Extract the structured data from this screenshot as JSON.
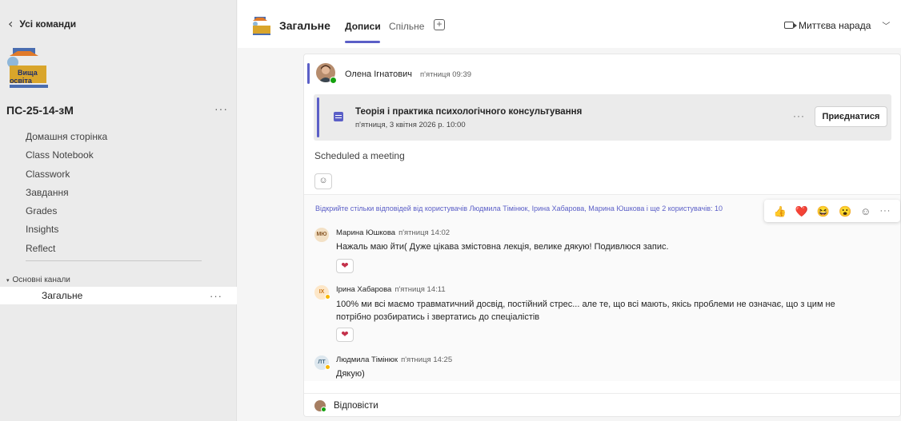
{
  "sidebar": {
    "back_label": "Усі команди",
    "team_name": "ПС-25-14-зМ",
    "team_logo_text": "Вища освіта",
    "more_glyph": "···",
    "nav_items": [
      {
        "label": "Домашня сторінка"
      },
      {
        "label": "Class Notebook"
      },
      {
        "label": "Classwork"
      },
      {
        "label": "Завдання"
      },
      {
        "label": "Grades"
      },
      {
        "label": "Insights"
      },
      {
        "label": "Reflect"
      }
    ],
    "section_label": "Основні канали",
    "channel_label": "Загальне"
  },
  "header": {
    "title": "Загальне",
    "tabs": [
      {
        "label": "Дописи",
        "active": true
      },
      {
        "label": "Спільне",
        "active": false
      }
    ],
    "add_tab_glyph": "+",
    "meet_label": "Миттєва нарада"
  },
  "post": {
    "author": "Олена Ігнатович",
    "time": "п'ятниця 09:39",
    "meeting": {
      "title": "Теорія і практика психологічного консультування",
      "date": "п'ятниця, 3 квітня 2026 р. 10:00",
      "join_label": "Приєднатися",
      "more_glyph": "···"
    },
    "body": "Scheduled a meeting",
    "open_replies": "Відкрийте стільки відповідей від користувачів Людмила Тімінюк, Ірина Хабарова, Марина Юшкова і ще 2 користувачів: 10",
    "reactions": [
      "👍",
      "❤️",
      "😆",
      "😮",
      "☺",
      "···"
    ],
    "replies": [
      {
        "initials": "МЮ",
        "author": "Марина Юшкова",
        "time": "п'ятниця 14:02",
        "text": "Нажаль маю йти(  Дуже цікава змістовна лекція, велике дякую!  Подивлюся запис.",
        "reaction": "❤"
      },
      {
        "initials": "ІХ",
        "author": "Ірина Хабарова",
        "time": "п'ятниця 14:11",
        "text": "100% ми всі маємо травматичний досвід, постійний стрес... але те, що всі мають, якісь проблеми не означає, що з цим не потрібно розбиратись і звертатись до спеціалістів",
        "reaction": "❤"
      },
      {
        "initials": "ЛТ",
        "author": "Людмила Тімінюк",
        "time": "п'ятниця 14:25",
        "text": "Дякую)"
      }
    ],
    "reply_label": "Відповісти"
  },
  "colors": {
    "accent": "#5b5fc7",
    "heart": "#c4314b",
    "presence_online": "#13a10e",
    "presence_away": "#f8b600"
  }
}
